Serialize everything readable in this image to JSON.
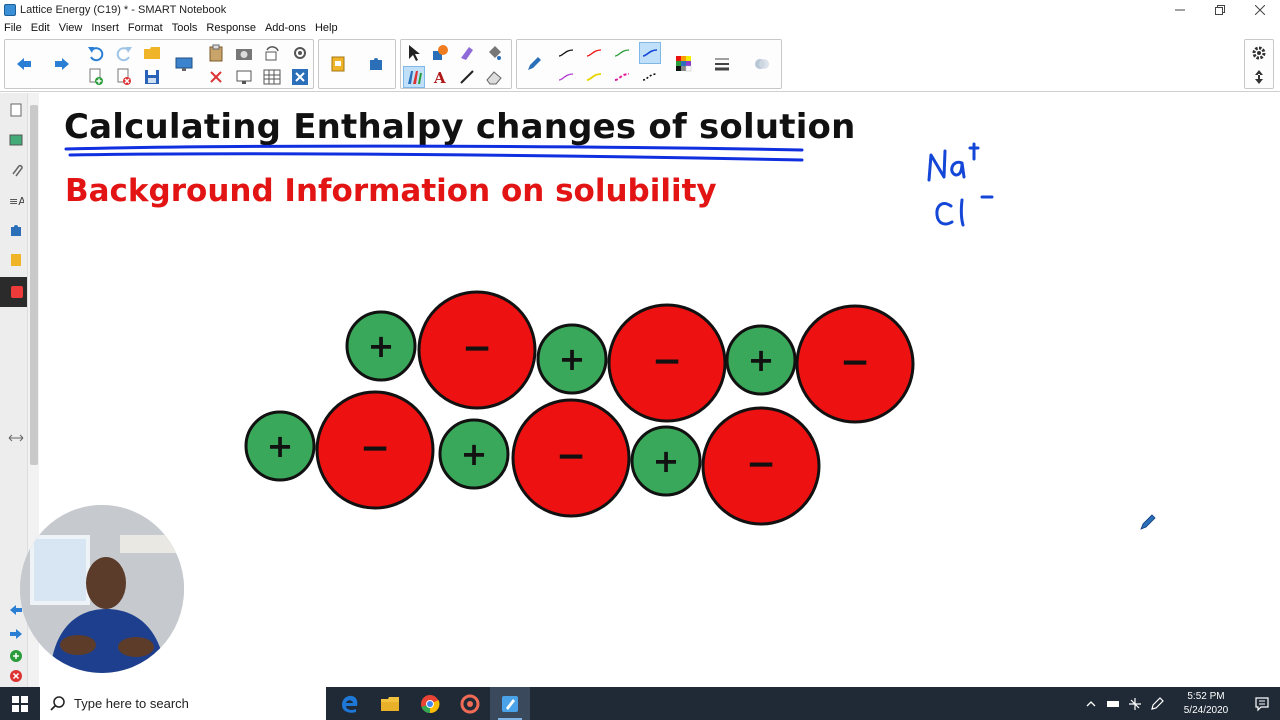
{
  "window": {
    "title": "Lattice Energy (C19) * - SMART Notebook",
    "minimize_icon": "minimize-icon",
    "restore_icon": "restore-icon",
    "close_icon": "close-icon"
  },
  "menu": {
    "items": [
      "File",
      "Edit",
      "View",
      "Insert",
      "Format",
      "Tools",
      "Response",
      "Add-ons",
      "Help"
    ]
  },
  "page": {
    "title": "Calculating Enthalpy changes of solution",
    "subtitle": "Background Information on solubility",
    "handwriting": {
      "cation": "Na+",
      "anion": "Cl-"
    }
  },
  "lattice": {
    "cation_color": "#3aa85a",
    "anion_color": "#ee1111",
    "cation_symbol": "+",
    "anion_symbol": "−"
  },
  "colors": {
    "title_underline": "#1030e0",
    "subtitle": "#e31414",
    "handwriting_ink": "#1446d8"
  },
  "taskbar": {
    "search_placeholder": "Type here to search",
    "time": "5:52 PM",
    "date": "5/24/2020"
  }
}
